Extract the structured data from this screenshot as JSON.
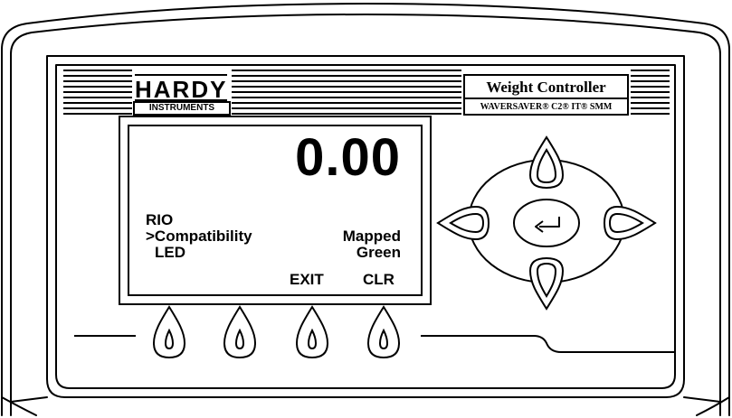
{
  "brand": {
    "name": "HARDY",
    "subtitle": "INSTRUMENTS"
  },
  "product": {
    "title": "Weight Controller",
    "models": "WAVERSAVER® C2® IT® SMM"
  },
  "display": {
    "weight": "0.00",
    "menu": {
      "parent": "RIO",
      "selected": ">Compatibility",
      "child": "LED"
    },
    "values": {
      "compatibility": "Mapped",
      "led": "Green"
    },
    "softkeys": {
      "exit": "EXIT",
      "clear": "CLR"
    }
  },
  "icons": {
    "enter": "enter-arrow-icon",
    "nav": [
      "up-arrow-key",
      "down-arrow-key",
      "left-arrow-key",
      "right-arrow-key"
    ],
    "softkeys": [
      "soft-key-1",
      "soft-key-2",
      "soft-key-3",
      "soft-key-4"
    ]
  },
  "colors": {
    "outline": "#000000",
    "background": "#ffffff"
  }
}
